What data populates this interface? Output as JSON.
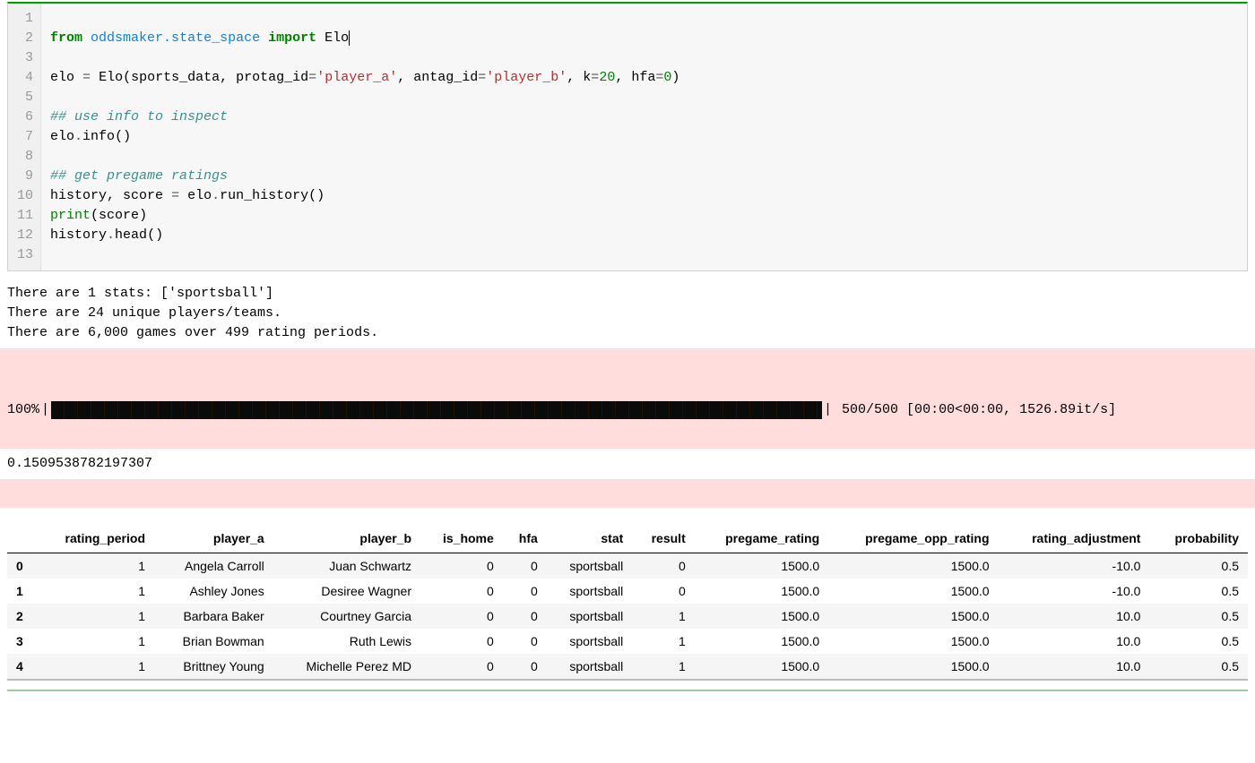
{
  "code": {
    "lines": [
      "",
      "from oddsmaker.state_space import Elo",
      "",
      "elo = Elo(sports_data, protag_id='player_a', antag_id='player_b', k=20, hfa=0)",
      "",
      "## use info to inspect",
      "elo.info()",
      "",
      "## get pregame ratings",
      "history, score = elo.run_history()",
      "print(score)",
      "history.head()",
      ""
    ],
    "line_numbers": [
      "1",
      "2",
      "3",
      "4",
      "5",
      "6",
      "7",
      "8",
      "9",
      "10",
      "11",
      "12",
      "13"
    ]
  },
  "output": {
    "info_lines": [
      "There are 1 stats: ['sportsball']",
      "There are 24 unique players/teams.",
      "There are 6,000 games over 499 rating periods."
    ],
    "progress_pct": "100%",
    "progress_stats": " 500/500 [00:00<00:00, 1526.89it/s]",
    "score_value": "0.1509538782197307"
  },
  "dataframe": {
    "columns": [
      "rating_period",
      "player_a",
      "player_b",
      "is_home",
      "hfa",
      "stat",
      "result",
      "pregame_rating",
      "pregame_opp_rating",
      "rating_adjustment",
      "probability"
    ],
    "index": [
      "0",
      "1",
      "2",
      "3",
      "4"
    ],
    "rows": [
      [
        "1",
        "Angela Carroll",
        "Juan Schwartz",
        "0",
        "0",
        "sportsball",
        "0",
        "1500.0",
        "1500.0",
        "-10.0",
        "0.5"
      ],
      [
        "1",
        "Ashley Jones",
        "Desiree Wagner",
        "0",
        "0",
        "sportsball",
        "0",
        "1500.0",
        "1500.0",
        "-10.0",
        "0.5"
      ],
      [
        "1",
        "Barbara Baker",
        "Courtney Garcia",
        "0",
        "0",
        "sportsball",
        "1",
        "1500.0",
        "1500.0",
        "10.0",
        "0.5"
      ],
      [
        "1",
        "Brian Bowman",
        "Ruth Lewis",
        "0",
        "0",
        "sportsball",
        "1",
        "1500.0",
        "1500.0",
        "10.0",
        "0.5"
      ],
      [
        "1",
        "Brittney Young",
        "Michelle Perez MD",
        "0",
        "0",
        "sportsball",
        "1",
        "1500.0",
        "1500.0",
        "10.0",
        "0.5"
      ]
    ]
  }
}
